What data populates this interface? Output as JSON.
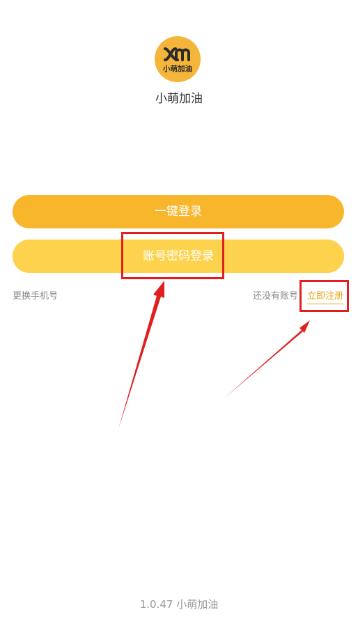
{
  "app": {
    "logo_text": "小萌加油",
    "name": "小萌加油",
    "version_text": "1.0.47 小萌加油"
  },
  "login": {
    "quick_login_label": "一键登录",
    "password_login_label": "账号密码登录",
    "change_phone_label": "更换手机号",
    "no_account_text": "还没有账号",
    "register_label": "立即注册"
  },
  "colors": {
    "logo_bg": "#f5b53a",
    "primary_button": "#f7b62c",
    "secondary_button": "#fdd34d",
    "accent_link": "#e8a418",
    "annotation_red": "#e02020"
  },
  "icons": {
    "logo": "xm-logo-icon"
  }
}
